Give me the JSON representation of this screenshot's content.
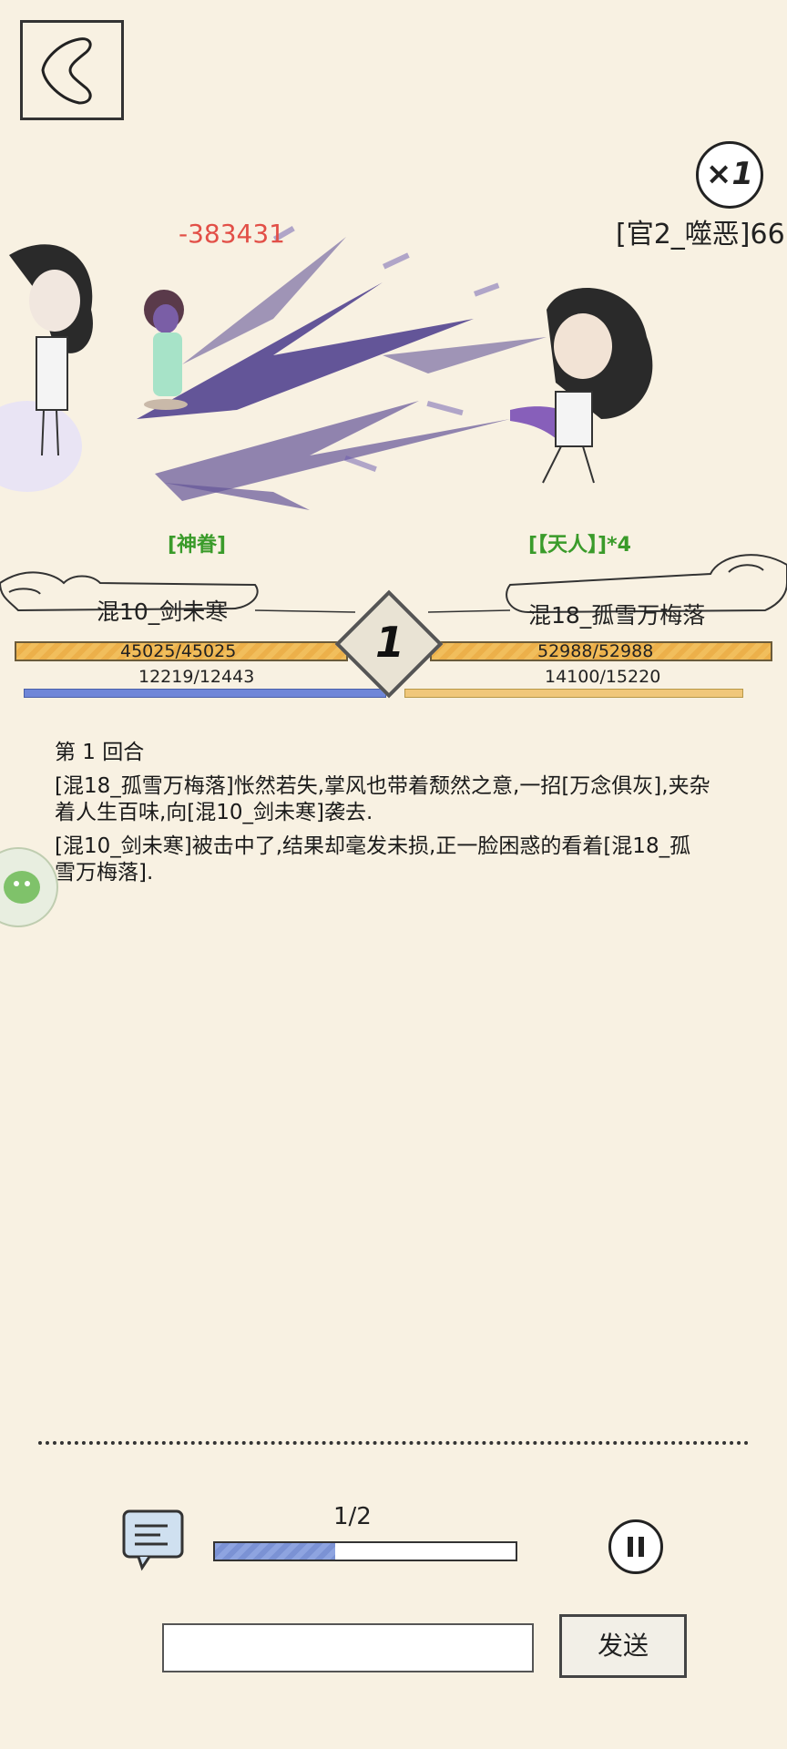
{
  "header": {
    "speed_label": "×1",
    "top_right_label": "[官2_噬恶]66"
  },
  "battle": {
    "damage_number": "-383431",
    "left_status": "[神眷]",
    "right_status": "[【天人】]*4",
    "left_name": "混10_剑未寒",
    "right_name": "混18_孤雪万梅落",
    "round_number": "1",
    "left_hp": "45025/45025",
    "right_hp": "52988/52988",
    "left_mp": "12219/12443",
    "right_mp": "14100/15220"
  },
  "log": {
    "round_title": "第 1 回合",
    "line1": "[混18_孤雪万梅落]怅然若失,掌风也带着颓然之意,一招[万念俱灰],夹杂着人生百味,向[混10_剑未寒]袭去.",
    "line2": "[混10_剑未寒]被击中了,结果却毫发未损,正一脸困惑的看着[混18_孤雪万梅落]."
  },
  "controls": {
    "progress_label": "1/2",
    "progress_fraction": 0.4,
    "send_label": "发送",
    "input_value": ""
  },
  "icons": {
    "back": "back-icon",
    "speed": "speed-icon",
    "chat": "chat-icon",
    "pause": "pause-icon"
  }
}
